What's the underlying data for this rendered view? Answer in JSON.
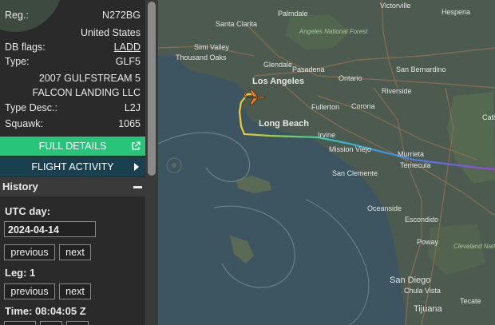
{
  "info": {
    "reg_label": "Reg.:",
    "reg": "N272BG",
    "country": "United States",
    "db_flags_label": "DB flags:",
    "db_flags": "LADD",
    "type_label": "Type:",
    "type": "GLF5",
    "model": "2007 GULFSTREAM 5",
    "owner": "FALCON LANDING LLC",
    "type_desc_label": "Type Desc.:",
    "type_desc": "L2J",
    "squawk_label": "Squawk:",
    "squawk": "1065"
  },
  "buttons": {
    "full_details": "FULL DETAILS",
    "flight_activity": "FLIGHT ACTIVITY"
  },
  "history": {
    "title": "History",
    "utc_day_label": "UTC day:",
    "date": "2024-04-14",
    "previous": "previous",
    "next": "next",
    "leg_label": "Leg: 1",
    "time_label": "Time: 08:04:05 Z"
  },
  "map": {
    "labels": [
      "Victorville",
      "Santa Clarita",
      "Angeles National Forest",
      "Hesperia",
      "Simi Valley",
      "Thousand Oaks",
      "Palmdale",
      "Glendale",
      "Los Angeles",
      "Pasadena",
      "Ontario",
      "San Bernardino",
      "Fullerton",
      "Corona",
      "Riverside",
      "Long Beach",
      "Irvine",
      "Mission Viejo",
      "Murrieta",
      "Temecula",
      "San Clemente",
      "Oceanside",
      "Escondido",
      "Poway",
      "Cleveland National Forest",
      "San Diego",
      "Chula Vista",
      "Tijuana",
      "Tecate",
      "Cath"
    ],
    "colors": {
      "land": "#4a5a4f",
      "water": "#3d5560",
      "road": "#8a6d55",
      "track_start": "#f6c830",
      "track_end": "#9b42d9",
      "aircraft": "#f07a18"
    }
  }
}
